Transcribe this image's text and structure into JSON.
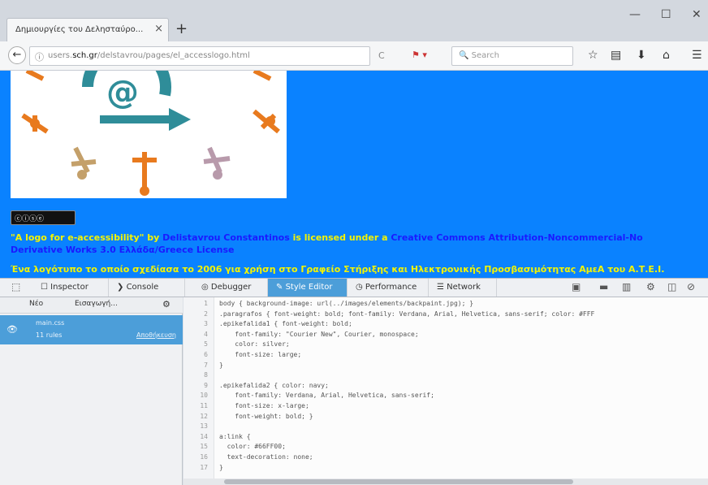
{
  "browser": {
    "tab_title": "Δημιουργίες του Δελησταύρο...",
    "tab_close": "×",
    "new_tab": "+",
    "window_controls": {
      "minimize": "—",
      "maximize": "☐",
      "close": "✕"
    },
    "url_prefix": "users.",
    "url_host": "sch.gr",
    "url_path": "/delstavrou/pages/el_accesslogo.html",
    "search_placeholder": "Search",
    "reload": "C"
  },
  "page": {
    "cc_badge": "ⓒⓘⓢⓔ",
    "license_line1": "\"A logo for e-accessibility\" by ",
    "license_author": "Delistavrou Constantinos",
    "license_mid": " is licensed under a ",
    "license_link": "Creative Commons Attribution-Noncommercial-No",
    "license_line2": "Derivative Works 3.0 Ελλάδα/Greece License",
    "note_text": "Ένα λογότυπο το οποίο σχεδίασα το 2006 για χρήση στο Γραφείο Στήριξης και Ηλεκτρονικής Προσβασιμότητας ΑμεΑ του Α.Τ.Ε.Ι."
  },
  "devtools": {
    "tabs": [
      {
        "label": "Inspector",
        "icon": "☐"
      },
      {
        "label": "Console",
        "icon": "❯"
      },
      {
        "label": "Debugger",
        "icon": "◎"
      },
      {
        "label": "Style Editor",
        "icon": "✎"
      },
      {
        "label": "Performance",
        "icon": "◷"
      },
      {
        "label": "Network",
        "icon": "☰"
      }
    ],
    "sidebar": {
      "new_btn": "Νέο",
      "import_btn": "Εισαγωγή...",
      "file_name": "main.css",
      "rules": "11 rules",
      "save": "Αποθήκευση"
    },
    "code_lines": [
      "body { background-image: url(../images/elements/backpaint.jpg); }",
      ".paragrafos { font-weight: bold; font-family: Verdana, Arial, Helvetica, sans-serif; color: #FFF",
      ".epikefalida1 { font-weight: bold;",
      "    font-family: \"Courier New\", Courier, monospace;",
      "    color: silver;",
      "    font-size: large;",
      "}",
      "",
      ".epikefalida2 { color: navy;",
      "    font-family: Verdana, Arial, Helvetica, sans-serif;",
      "    font-size: x-large;",
      "    font-weight: bold; }",
      "",
      "a:link {",
      "  color: #66FF00;",
      "  text-decoration: none;",
      "}"
    ]
  }
}
